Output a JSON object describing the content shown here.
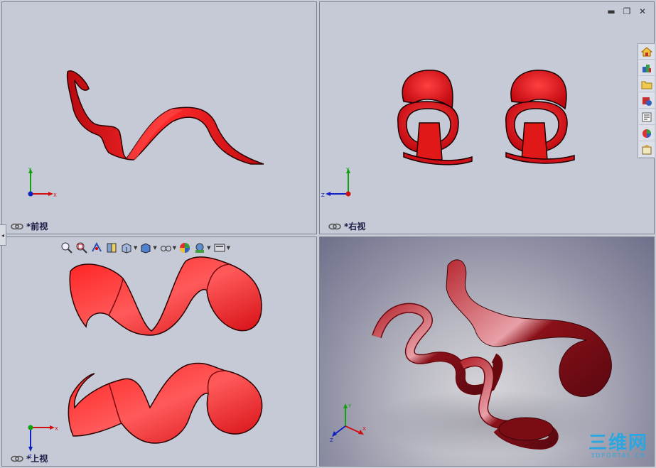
{
  "viewports": {
    "front": {
      "label": "*前视"
    },
    "right": {
      "label": "*右视"
    },
    "top": {
      "label": "*上视"
    }
  },
  "axes": {
    "x": "X",
    "y": "Y",
    "z": "Z"
  },
  "colors": {
    "model_red": "#e8141a",
    "model_dark": "#7a0a10",
    "axis_x": "#d01010",
    "axis_y": "#10a010",
    "axis_z": "#1020c0",
    "viewport_bg": "#c6cad6",
    "watermark": "#2aa7e0"
  },
  "window_controls": [
    "minimize-icon",
    "restore-icon",
    "close-icon"
  ],
  "taskpane_icons": [
    "home-icon",
    "resources-icon",
    "folder-icon",
    "design-library-icon",
    "properties-icon",
    "appearance-icon",
    "custom-properties-icon"
  ],
  "hud_toolbar_icons": [
    "zoom-to-fit-icon",
    "zoom-area-icon",
    "previous-view-icon",
    "section-view-icon",
    "view-orientation-icon",
    "display-style-icon",
    "hide-show-icon",
    "edit-appearance-icon",
    "apply-scene-icon",
    "view-settings-icon"
  ],
  "watermark": {
    "main": "三维网",
    "sub": "3DPORTAL.CN"
  }
}
